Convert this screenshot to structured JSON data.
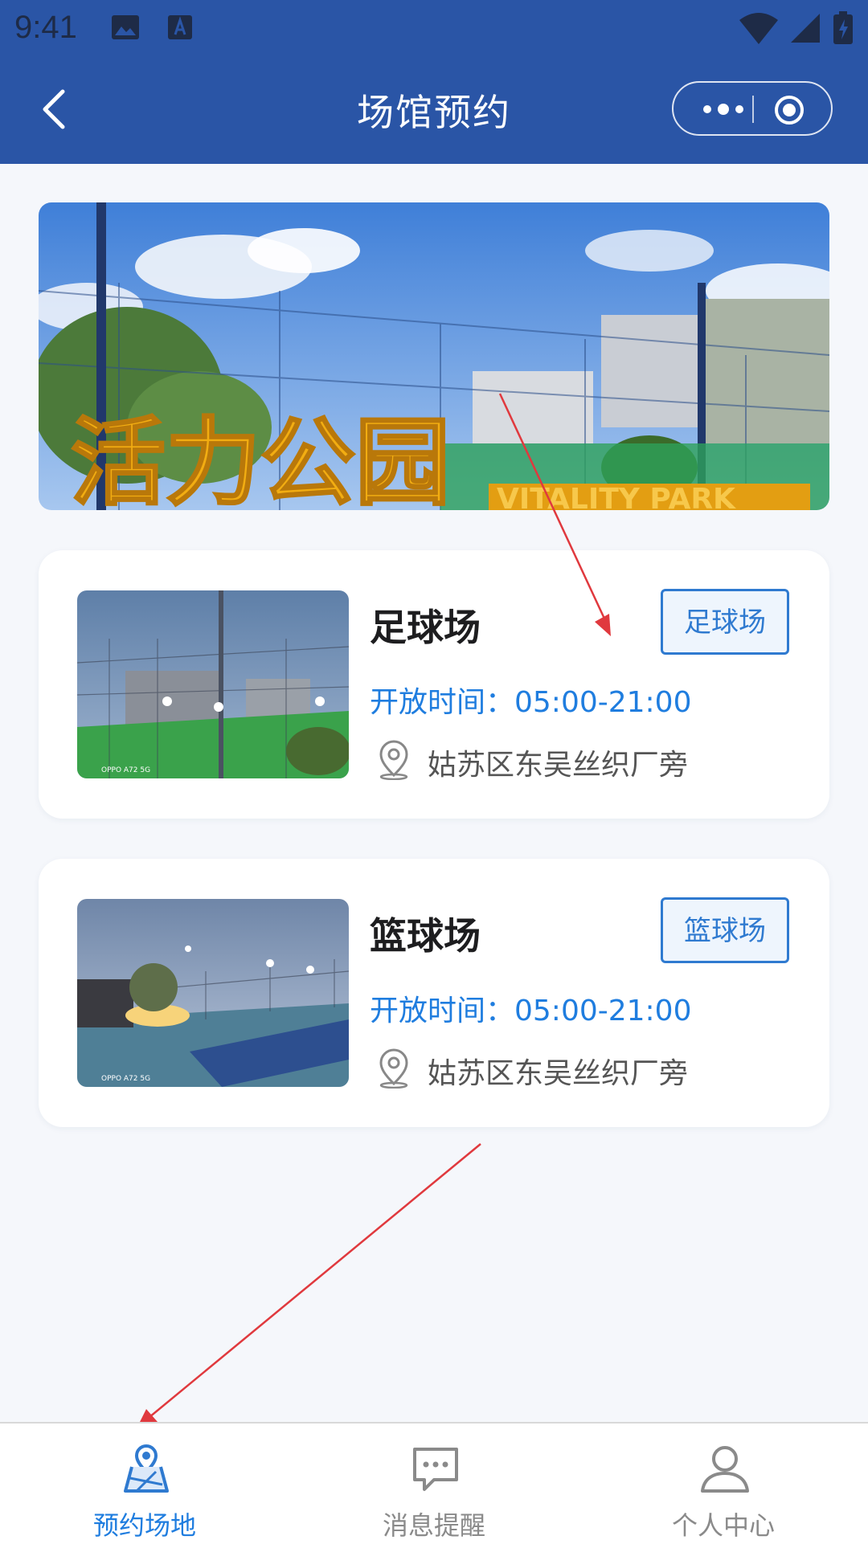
{
  "status_bar": {
    "time": "9:41"
  },
  "nav": {
    "title": "场馆预约"
  },
  "banner": {
    "sign_text": "活力公园",
    "sign_english": "VITALITY PARK"
  },
  "venues": [
    {
      "name": "足球场",
      "tag": "足球场",
      "hours": "开放时间：05:00-21:00",
      "address": "姑苏区东吴丝织厂旁",
      "photo_caption": "OPPO A72 5G"
    },
    {
      "name": "篮球场",
      "tag": "篮球场",
      "hours": "开放时间：05:00-21:00",
      "address": "姑苏区东吴丝织厂旁",
      "photo_caption": "OPPO A72 5G"
    }
  ],
  "tabs": [
    {
      "label": "预约场地",
      "icon": "location-map-icon",
      "active": true
    },
    {
      "label": "消息提醒",
      "icon": "chat-bubble-icon",
      "active": false
    },
    {
      "label": "个人中心",
      "icon": "user-icon",
      "active": false
    }
  ],
  "colors": {
    "primary": "#2a55a6",
    "accent": "#1f7ddf",
    "annotation": "#e0393e"
  }
}
